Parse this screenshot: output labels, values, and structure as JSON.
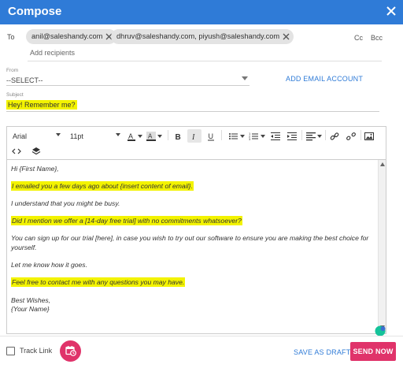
{
  "window": {
    "title": "Compose"
  },
  "recipients": {
    "to_label": "To",
    "chips": [
      "anil@saleshandy.com",
      "dhruv@saleshandy.com, piyush@saleshandy.com"
    ],
    "add_placeholder": "Add recipients",
    "cc_label": "Cc",
    "bcc_label": "Bcc"
  },
  "from": {
    "label": "From",
    "value": "--SELECT--",
    "add_account_label": "ADD EMAIL ACCOUNT"
  },
  "subject": {
    "label": "Subject",
    "value": "Hey! Remember me?"
  },
  "toolbar": {
    "font_family": "Arial",
    "font_size": "11pt"
  },
  "email_body": [
    {
      "text": "Hi {First Name},",
      "highlight": false
    },
    {
      "text": "I emailed you a few days ago about {insert content of email}.",
      "highlight": true
    },
    {
      "text": "I understand that you might be busy.",
      "highlight": false
    },
    {
      "text": "Did I mention we offer a [14-day free trial] with no commitments whatsoever?",
      "highlight": true
    },
    {
      "text": "You can sign up for our trial [here], in case you wish to try out our software to ensure you are making the best choice for",
      "highlight": false
    },
    {
      "text": "yourself.",
      "highlight": false
    },
    {
      "text": "Let me know how it goes.",
      "highlight": false
    },
    {
      "text": "Feel free to contact me with any questions you may have.",
      "highlight": true
    },
    {
      "text": "Best Wishes,",
      "highlight": false
    },
    {
      "text": "{Your Name}",
      "highlight": false
    }
  ],
  "footer": {
    "track_link_label": "Track Link",
    "save_draft_label": "SAVE AS DRAFT",
    "send_label": "SEND NOW"
  },
  "colors": {
    "primary": "#2f7bd7",
    "accent": "#e0336a",
    "highlight": "#f3f300"
  }
}
